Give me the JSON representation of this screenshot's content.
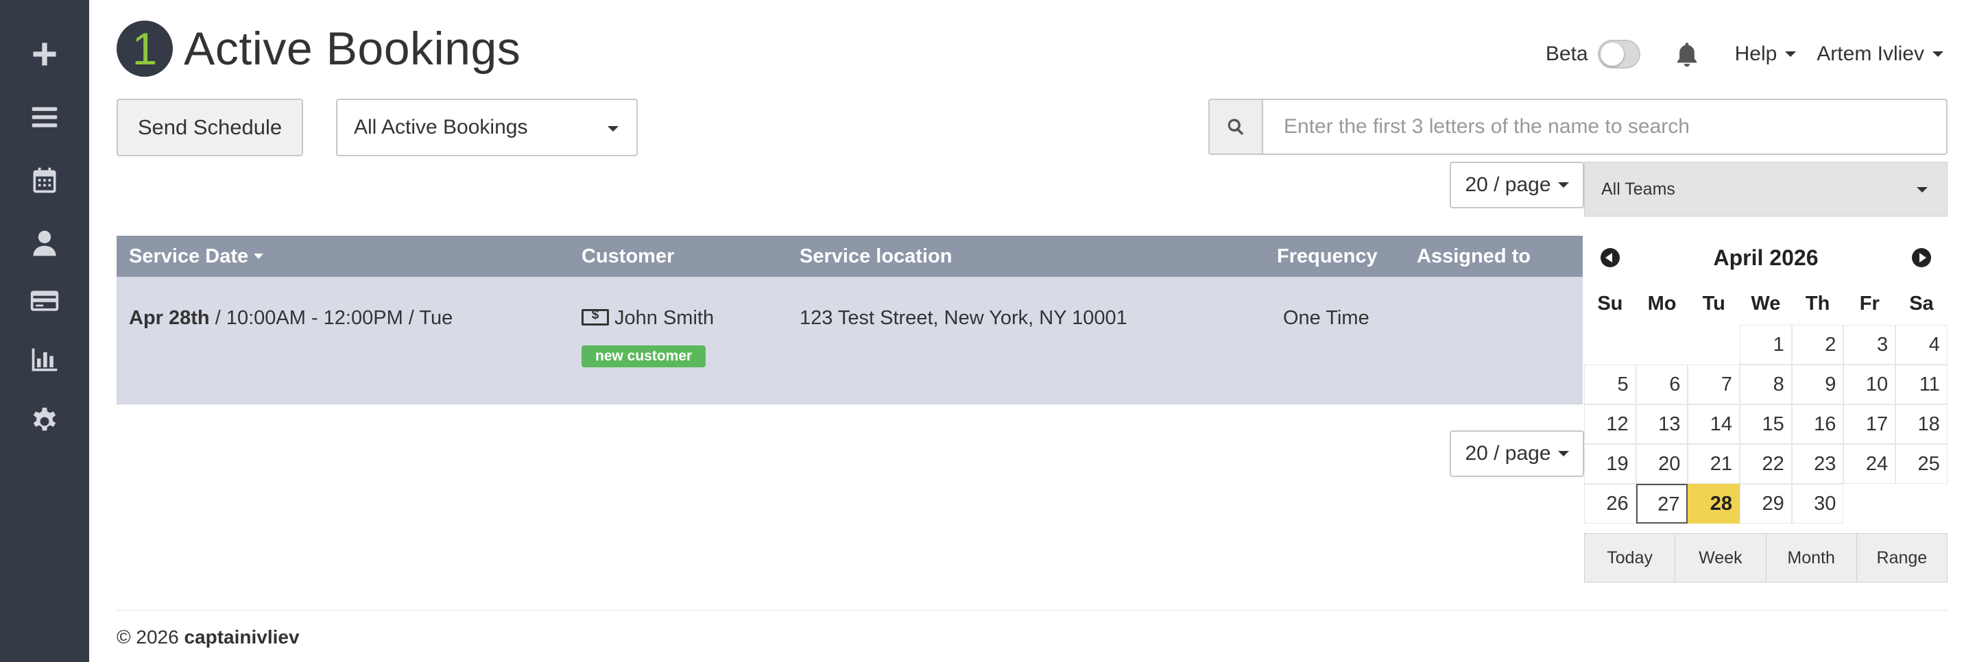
{
  "header": {
    "count": "1",
    "title": "Active Bookings"
  },
  "topbar": {
    "beta_label": "Beta",
    "help_label": "Help",
    "user_name": "Artem Ivliev"
  },
  "toolbar": {
    "send_schedule_label": "Send Schedule",
    "filter_selected": "All Active Bookings",
    "search_placeholder": "Enter the first 3 letters of the name to search",
    "per_page_top": "20 / page",
    "per_page_bottom": "20 / page",
    "teams_selected": "All Teams"
  },
  "table": {
    "columns": {
      "service_date": "Service Date",
      "customer": "Customer",
      "service_location": "Service location",
      "frequency": "Frequency",
      "assigned_to": "Assigned to"
    },
    "rows": [
      {
        "date": "Apr 28th",
        "time_rest": " / 10:00AM - 12:00PM / Tue",
        "customer": "John Smith",
        "badge": "new customer",
        "location": "123 Test Street, New York, NY 10001",
        "frequency": "One Time",
        "assigned_to": ""
      }
    ]
  },
  "calendar": {
    "title": "April 2026",
    "weekdays": [
      "Su",
      "Mo",
      "Tu",
      "We",
      "Th",
      "Fr",
      "Sa"
    ],
    "weeks": [
      [
        "",
        "",
        "",
        "1",
        "2",
        "3",
        "4"
      ],
      [
        "5",
        "6",
        "7",
        "8",
        "9",
        "10",
        "11"
      ],
      [
        "12",
        "13",
        "14",
        "15",
        "16",
        "17",
        "18"
      ],
      [
        "19",
        "20",
        "21",
        "22",
        "23",
        "24",
        "25"
      ],
      [
        "26",
        "27",
        "28",
        "29",
        "30",
        "",
        ""
      ]
    ],
    "highlighted_day": "28",
    "outlined_day": "27",
    "buttons": [
      "Today",
      "Week",
      "Month",
      "Range"
    ]
  },
  "footer": {
    "copyright": "© 2026 ",
    "brand": "captainivliev"
  },
  "colors": {
    "sidebar_bg": "#343a46",
    "count_text": "#8dc63f",
    "table_header": "#8e97a8",
    "row_bg": "#d8dbe6",
    "badge_green": "#5cb85c",
    "today_yellow": "#f0d350"
  },
  "icons": {
    "sidebar": [
      "plus-icon",
      "list-icon",
      "calendar-icon",
      "user-icon",
      "credit-card-icon",
      "bar-chart-icon",
      "gear-icon"
    ]
  }
}
